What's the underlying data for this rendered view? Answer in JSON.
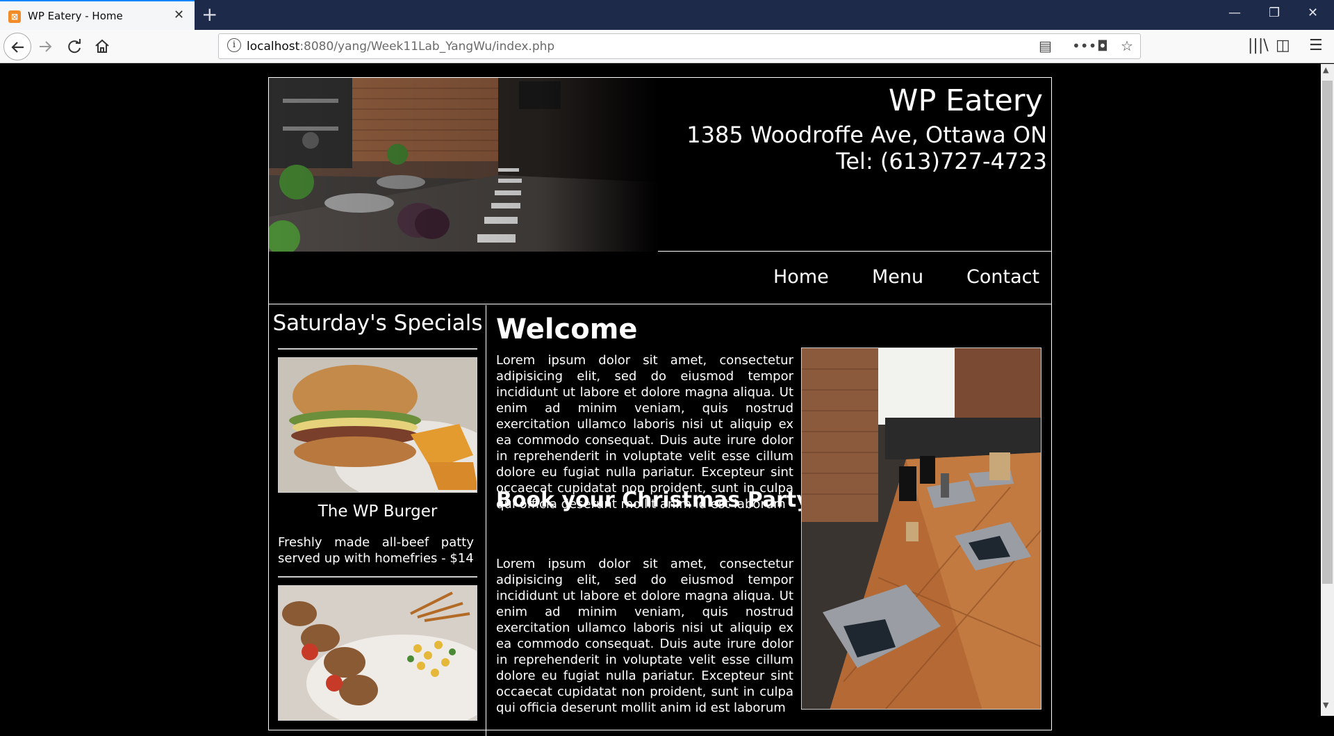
{
  "browser": {
    "tab_title": "WP Eatery - Home",
    "tab_close": "✕",
    "new_tab": "+",
    "url_host": "localhost",
    "url_rest": ":8080/yang/Week11Lab_YangWu/index.php",
    "window_controls": [
      "—",
      "❐",
      "✕"
    ]
  },
  "site": {
    "title": "WP Eatery",
    "address": "1385 Woodroffe Ave, Ottawa ON",
    "tel": "Tel: (613)727-4723",
    "nav": [
      "Home",
      "Menu",
      "Contact"
    ]
  },
  "sidebar": {
    "heading": "Saturday's Specials",
    "specials": [
      {
        "name": "The WP Burger",
        "description": "Freshly made all-beef patty served up with homefries - $14"
      },
      {
        "name": "",
        "description": ""
      }
    ]
  },
  "main": {
    "welcome": "Welcome",
    "paragraph1": "Lorem ipsum dolor sit amet, consectetur adipisicing elit, sed do eiusmod tempor incididunt ut labore et dolore magna aliqua. Ut enim ad minim veniam, quis nostrud exercitation ullamco laboris nisi ut aliquip ex ea commodo consequat. Duis aute irure dolor in reprehenderit in voluptate velit esse cillum dolore eu fugiat nulla pariatur. Excepteur sint occaecat cupidatat non proident, sunt in culpa qui officia deserunt mollit anim id est laborum",
    "party_heading": "Book your Christmas Party!",
    "paragraph2": "Lorem ipsum dolor sit amet, consectetur adipisicing elit, sed do eiusmod tempor incididunt ut labore et dolore magna aliqua. Ut enim ad minim veniam, quis nostrud exercitation ullamco laboris nisi ut aliquip ex ea commodo consequat. Duis aute irure dolor in reprehenderit in voluptate velit esse cillum dolore eu fugiat nulla pariatur. Excepteur sint occaecat cupidatat non proident, sunt in culpa qui officia deserunt mollit anim id est laborum"
  },
  "icons": {
    "back": "back-arrow-icon",
    "forward": "forward-arrow-icon",
    "reload": "reload-icon",
    "home": "home-icon",
    "info": "info-icon",
    "reader": "reader-view-icon",
    "more": "more-icon",
    "pocket": "pocket-icon",
    "bookmark": "star-icon",
    "library": "library-icon",
    "sidebar": "sidebar-icon",
    "menu": "hamburger-menu-icon"
  }
}
